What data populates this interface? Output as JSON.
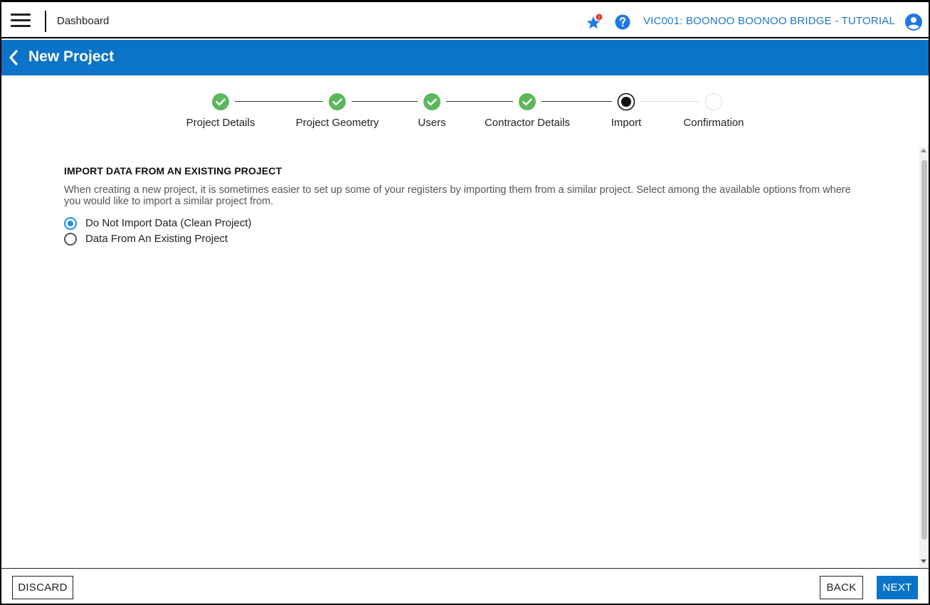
{
  "topbar": {
    "dashboard_label": "Dashboard",
    "project_name": "VIC001: BOONOO BOONOO BRIDGE - TUTORIAL",
    "notification_badge": "!"
  },
  "header": {
    "title": "New Project"
  },
  "stepper": {
    "steps": [
      {
        "label": "Project Details",
        "state": "complete"
      },
      {
        "label": "Project Geometry",
        "state": "complete"
      },
      {
        "label": "Users",
        "state": "complete"
      },
      {
        "label": "Contractor Details",
        "state": "complete"
      },
      {
        "label": "Import",
        "state": "active"
      },
      {
        "label": "Confirmation",
        "state": "pending"
      }
    ]
  },
  "import_section": {
    "title": "IMPORT DATA FROM AN EXISTING PROJECT",
    "description": "When creating a new project, it is sometimes easier to set up some of your registers by importing them from a similar project. Select among the available options from where you would like to import a similar project from.",
    "options": [
      {
        "label": "Do Not Import Data (Clean Project)",
        "selected": true
      },
      {
        "label": "Data From An Existing Project",
        "selected": false
      }
    ]
  },
  "footer": {
    "discard_label": "DISCARD",
    "back_label": "BACK",
    "next_label": "NEXT"
  },
  "colors": {
    "brand_blue": "#0b74c8",
    "link_blue": "#1e78c8",
    "step_complete": "#5cb85c",
    "radio_selected": "#1e90e6"
  }
}
